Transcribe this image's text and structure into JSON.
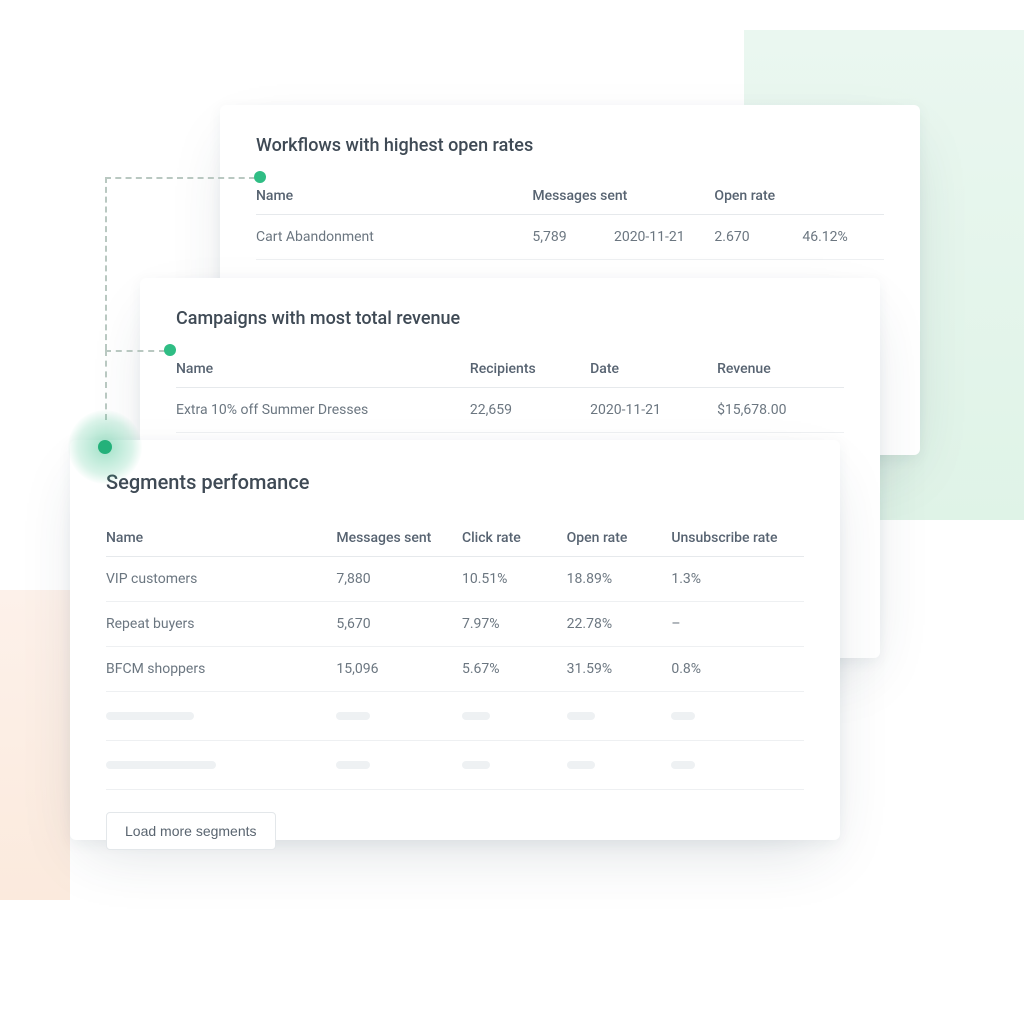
{
  "workflows": {
    "title": "Workflows with highest open rates",
    "columns": {
      "name": "Name",
      "messages": "Messages sent",
      "open": "Open rate"
    },
    "rows": [
      {
        "name": "Cart Abandonment",
        "messages": "5,789",
        "date": "2020-11-21",
        "val": "2.670",
        "open": "46.12%"
      }
    ]
  },
  "campaigns": {
    "title": "Campaigns with most total revenue",
    "columns": {
      "name": "Name",
      "recipients": "Recipients",
      "date": "Date",
      "revenue": "Revenue"
    },
    "rows": [
      {
        "name": "Extra 10% off Summer Dresses",
        "recipients": "22,659",
        "date": "2020-11-21",
        "revenue": "$15,678.00"
      }
    ]
  },
  "segments": {
    "title": "Segments perfomance",
    "columns": {
      "name": "Name",
      "messages": "Messages sent",
      "click": "Click rate",
      "open": "Open rate",
      "unsub": "Unsubscribe rate"
    },
    "rows": [
      {
        "name": "VIP customers",
        "messages": "7,880",
        "click": "10.51%",
        "open": "18.89%",
        "unsub": "1.3%"
      },
      {
        "name": "Repeat buyers",
        "messages": "5,670",
        "click": "7.97%",
        "open": "22.78%",
        "unsub": "–"
      },
      {
        "name": "BFCM shoppers",
        "messages": "15,096",
        "click": "5.67%",
        "open": "31.59%",
        "unsub": "0.8%"
      }
    ],
    "button": "Load more segments"
  }
}
